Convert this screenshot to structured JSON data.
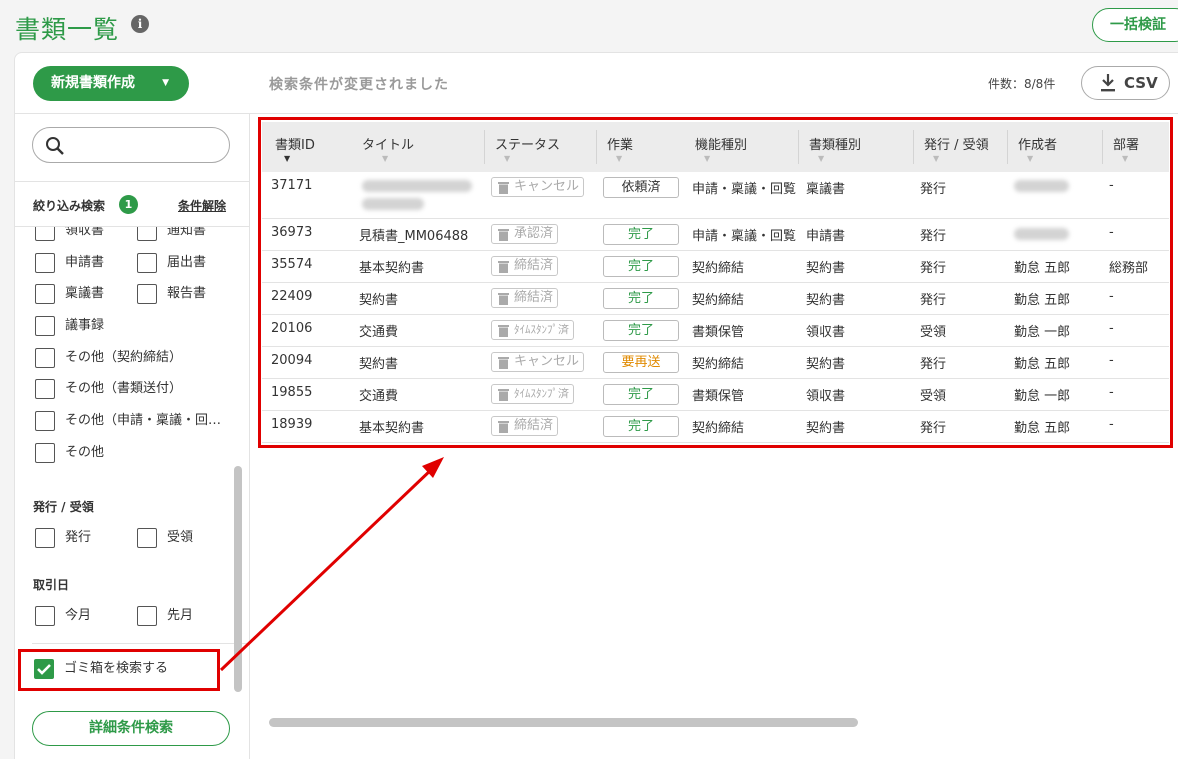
{
  "header": {
    "title": "書類一覧",
    "bulk_label": "一括検証"
  },
  "toolbar": {
    "new_doc_label": "新規書類作成",
    "status_message": "検索条件が変更されました",
    "count_text": "件数：8/8件",
    "csv_label": "CSV"
  },
  "sidebar": {
    "filter_title": "絞り込み検索",
    "filter_count": "1",
    "clear_label": "条件解除",
    "doc_types": [
      "領収書",
      "通知書",
      "申請書",
      "届出書",
      "稟議書",
      "報告書",
      "議事録",
      "その他（契約締結）",
      "その他（書類送付）",
      "その他（申請・稟議・回…",
      "その他"
    ],
    "issue_title": "発行 / 受領",
    "issue_options": [
      "発行",
      "受領"
    ],
    "date_title": "取引日",
    "date_options": [
      "今月",
      "先月"
    ],
    "trash_label": "ゴミ箱を検索する",
    "detail_label": "詳細条件検索"
  },
  "table": {
    "columns": [
      "書類ID",
      "タイトル",
      "ステータス",
      "作業",
      "機能種別",
      "書類種別",
      "発行 / 受領",
      "作成者",
      "部署"
    ],
    "rows": [
      {
        "id": "37171",
        "title": "",
        "status": "キャンセル",
        "work": "依頼済",
        "func": "申請・稟議・回覧",
        "type": "稟議書",
        "issue": "発行",
        "creator": "",
        "dept": "-"
      },
      {
        "id": "36973",
        "title": "見積書_MM06488",
        "status": "承認済",
        "work": "完了",
        "func": "申請・稟議・回覧",
        "type": "申請書",
        "issue": "発行",
        "creator": "",
        "dept": "-"
      },
      {
        "id": "35574",
        "title": "基本契約書",
        "status": "締結済",
        "work": "完了",
        "func": "契約締結",
        "type": "契約書",
        "issue": "発行",
        "creator": "勤怠 五郎",
        "dept": "総務部"
      },
      {
        "id": "22409",
        "title": "契約書",
        "status": "締結済",
        "work": "完了",
        "func": "契約締結",
        "type": "契約書",
        "issue": "発行",
        "creator": "勤怠 五郎",
        "dept": "-"
      },
      {
        "id": "20106",
        "title": "交通費",
        "status": "ﾀｲﾑｽﾀﾝﾌﾟ済",
        "work": "完了",
        "func": "書類保管",
        "type": "領収書",
        "issue": "受領",
        "creator": "勤怠 一郎",
        "dept": "-"
      },
      {
        "id": "20094",
        "title": "契約書",
        "status": "キャンセル",
        "work": "要再送",
        "func": "契約締結",
        "type": "契約書",
        "issue": "発行",
        "creator": "勤怠 五郎",
        "dept": "-"
      },
      {
        "id": "19855",
        "title": "交通費",
        "status": "ﾀｲﾑｽﾀﾝﾌﾟ済",
        "work": "完了",
        "func": "書類保管",
        "type": "領収書",
        "issue": "受領",
        "creator": "勤怠 一郎",
        "dept": "-"
      },
      {
        "id": "18939",
        "title": "基本契約書",
        "status": "締結済",
        "work": "完了",
        "func": "契約締結",
        "type": "契約書",
        "issue": "発行",
        "creator": "勤怠 五郎",
        "dept": "-"
      }
    ]
  },
  "colors": {
    "accent": "#2e9a48",
    "highlight": "#e00000",
    "warning": "#e08a00"
  },
  "icons": [
    "info-icon",
    "search-icon",
    "download-icon",
    "trash-icon",
    "check-icon",
    "chevron-down-icon",
    "sort-caret-icon"
  ]
}
